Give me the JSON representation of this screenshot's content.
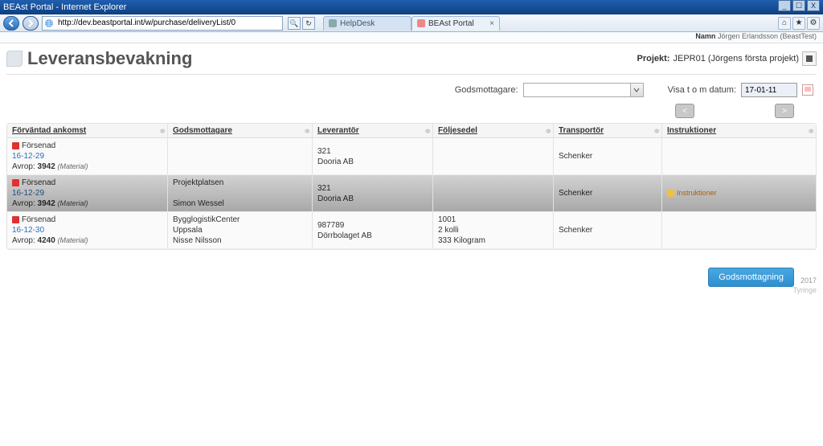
{
  "browser": {
    "title": "BEAst Portal - Internet Explorer",
    "url": "http://dev.beastportal.int/w/purchase/deliveryList/0",
    "tabs": [
      {
        "label": "HelpDesk"
      },
      {
        "label": "BEAst Portal"
      }
    ],
    "win_min": "_",
    "win_max": "☐",
    "win_close": "X",
    "search_glyph": "🔍",
    "refresh_glyph": "↻",
    "home_glyph": "⌂",
    "star_glyph": "★",
    "gear_glyph": "⚙"
  },
  "userstrip": {
    "name_label": "Namn",
    "name_value": "Jörgen Erlandsson (BeastTest)"
  },
  "header": {
    "title": "Leveransbevakning",
    "project_label": "Projekt:",
    "project_value": "JEPR01 (Jörgens första projekt)"
  },
  "filters": {
    "recipient_label": "Godsmottagare:",
    "date_label": "Visa t o m datum:",
    "date_value": "17-01-11"
  },
  "pager": {
    "prev": "<",
    "next": ">"
  },
  "columns": {
    "c1": "Förväntad ankomst",
    "c2": "Godsmottagare",
    "c3": "Leverantör",
    "c4": "Följesedel",
    "c5": "Transportör",
    "c6": "Instruktioner"
  },
  "status_text": "Försenad",
  "avrop_label": "Avrop:",
  "rows": [
    {
      "date": "16-12-29",
      "avrop_no": "3942",
      "avrop_type": "(Material)",
      "recipient_l1": "",
      "recipient_l2": "",
      "supplier_l1": "321",
      "supplier_l2": "Dooria AB",
      "note_l1": "",
      "note_l2": "",
      "carrier": "Schenker",
      "instr": ""
    },
    {
      "date": "16-12-29",
      "avrop_no": "3942",
      "avrop_type": "(Material)",
      "recipient_l1": "Projektplatsen",
      "recipient_l2": "Simon Wessel",
      "supplier_l1": "321",
      "supplier_l2": "Dooria AB",
      "note_l1": "",
      "note_l2": "",
      "carrier": "Schenker",
      "instr": "Instruktioner"
    },
    {
      "date": "16-12-30",
      "avrop_no": "4240",
      "avrop_type": "(Material)",
      "recipient_l1": "BygglogistikCenter",
      "recipient_l2": "Uppsala",
      "recipient_l3": "Nisse Nilsson",
      "supplier_l1": "987789",
      "supplier_l2": "Dörrbolaget AB",
      "note_l1": "1001",
      "note_l2": "2 kolli",
      "note_l3": "333 Kilogram",
      "carrier": "Schenker",
      "instr": ""
    }
  ],
  "actions": {
    "godsmottagning": "Godsmottagning"
  },
  "build": {
    "year": "2017",
    "brand": "Tyringe"
  }
}
